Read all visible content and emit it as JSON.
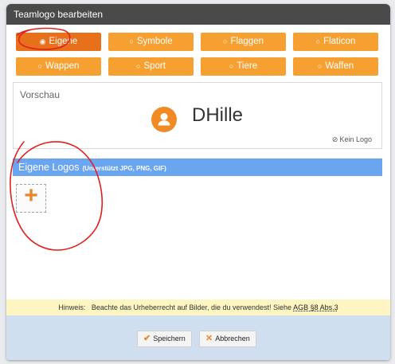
{
  "dialog": {
    "title": "Teamlogo bearbeiten"
  },
  "tabs": [
    {
      "label": "Eigene",
      "selected": true
    },
    {
      "label": "Symbole",
      "selected": false
    },
    {
      "label": "Flaggen",
      "selected": false
    },
    {
      "label": "Flaticon",
      "selected": false
    },
    {
      "label": "Wappen",
      "selected": false
    },
    {
      "label": "Sport",
      "selected": false
    },
    {
      "label": "Tiere",
      "selected": false
    },
    {
      "label": "Waffen",
      "selected": false
    }
  ],
  "preview": {
    "label": "Vorschau",
    "team_name": "DHille",
    "no_logo_label": "Kein Logo",
    "no_logo_icon": "ban-icon",
    "avatar_icon": "user-icon"
  },
  "own_logos": {
    "title": "Eigene Logos",
    "hint": "(Unterstützt JPG, PNG, GIF)",
    "add_symbol": "+"
  },
  "notice": {
    "label": "Hinweis:",
    "text": "Beachte das Urheberrecht auf Bilder, die du verwendest! Siehe",
    "link": "AGB §8 Abs.3"
  },
  "buttons": {
    "save": "Speichern",
    "cancel": "Abbrechen"
  },
  "colors": {
    "tab_selected": "#e8701a",
    "tab_default": "#f5a031",
    "header_bar": "#6aa5ef",
    "annotation": "#e02020"
  }
}
